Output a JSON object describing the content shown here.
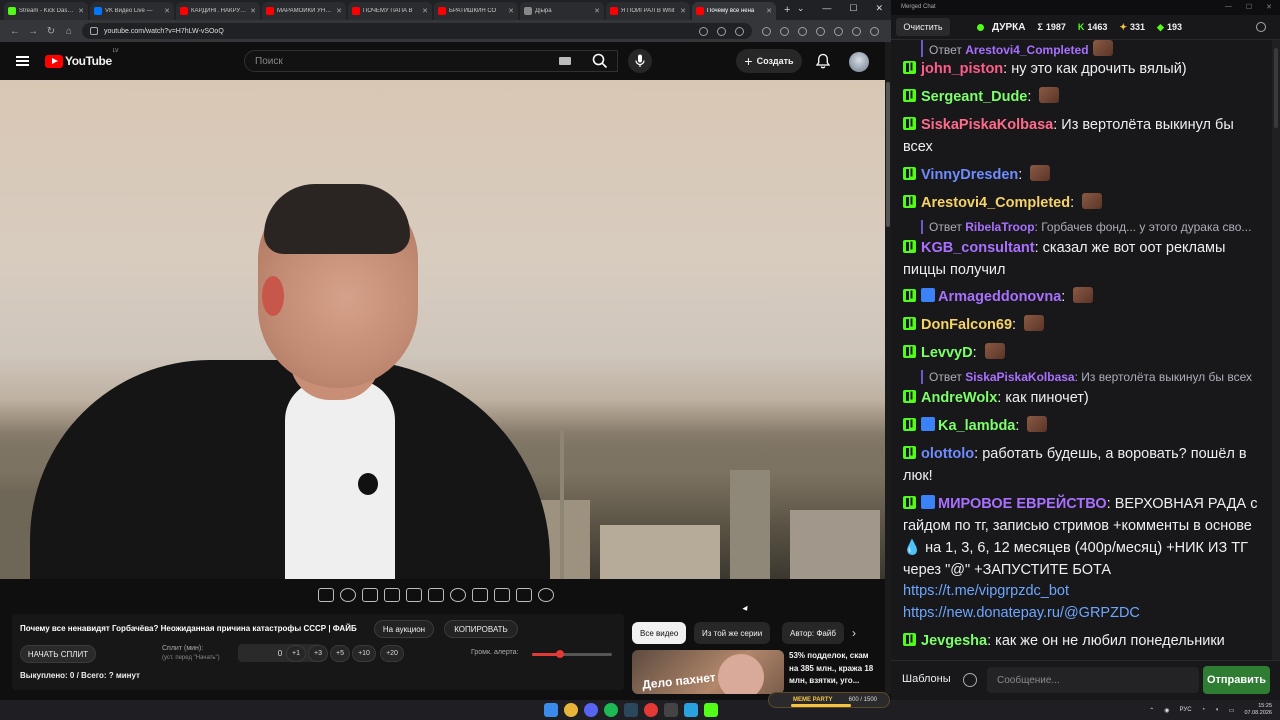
{
  "browser": {
    "tabs": [
      {
        "title": "Stream - Kick Dashboard",
        "color": "#53fc18",
        "active": false
      },
      {
        "title": "VK Видео Live —",
        "color": "#0077ff",
        "active": false
      },
      {
        "title": "КАРДИНГ. НАКРУТКА",
        "color": "#ff0000",
        "active": false
      },
      {
        "title": "МАРАМОЙКИ УНИЖ",
        "color": "#ff0000",
        "active": false
      },
      {
        "title": "ПОЧЕМУ ПАПА В",
        "color": "#ff0000",
        "active": false
      },
      {
        "title": "БРАТИШКИН СО",
        "color": "#ff0000",
        "active": false
      },
      {
        "title": "Д|ыра",
        "color": "#888888",
        "active": false
      },
      {
        "title": "Я ПОИГРАЛ В Whit",
        "color": "#ff0000",
        "active": false
      },
      {
        "title": "Почему все нена",
        "color": "#ff0000",
        "active": true
      }
    ],
    "url": "youtube.com/watch?v=H7hLW-vSOoQ"
  },
  "youtube": {
    "logo_text": "YouTube",
    "region": "LV",
    "search_placeholder": "Поиск",
    "create_label": "Создать",
    "video_title": "Почему все ненавидят Горбачёва? Неожиданная причина катастрофы СССР | ФАЙБ",
    "auction_label": "На аукцион",
    "copy_label": "КОПИРОВАТЬ",
    "start_split_label": "НАЧАТЬ СПЛИТ",
    "split_label": "Сплит (мин):",
    "split_sub": "(уст. перед \"Начать\")",
    "split_value": "0",
    "increments": [
      "+1",
      "+3",
      "+5",
      "+10",
      "+20"
    ],
    "volume_label": "Громк. алерта:",
    "volume_level": 0.35,
    "sold_text": "Выкуплено: 0 / Всего: ? минут",
    "chips": [
      "Все видео",
      "Из той же серии",
      "Автор: Файб"
    ],
    "rec_thumb_text": "Дело пахнет",
    "rec_title": "53% подделок, скам на 385 млн., кража 18 млн, взятки, уго..."
  },
  "chat": {
    "window_title": "Merged Chat",
    "clear_label": "Очистить",
    "channel": "ДУРКА",
    "stats": [
      {
        "icon": "Σ",
        "value": "1987",
        "color": "#efeff1"
      },
      {
        "icon": "K",
        "value": "1463",
        "color": "#53fc18"
      },
      {
        "icon": "✦",
        "value": "331",
        "color": "#f6c343"
      },
      {
        "icon": "◆",
        "value": "193",
        "color": "#53fc18"
      }
    ],
    "templates_label": "Шаблоны",
    "input_placeholder": "Сообщение...",
    "send_label": "Отправить",
    "meme_party_label": "MEME PARTY",
    "meme_party_count": "600 / 1500"
  },
  "messages": [
    {
      "type": "reply",
      "prefix": "Ответ",
      "user": "Arestovi4_Completed",
      "text": ""
    },
    {
      "type": "msg",
      "user": "john_piston",
      "color": "#ff5c8a",
      "text": "ну это как дрочить вялый)"
    },
    {
      "type": "msg",
      "user": "Sergeant_Dude",
      "color": "#7dff6a",
      "text": ""
    },
    {
      "type": "msg",
      "user": "SiskaPiskaKolbasa",
      "color": "#ff6b8b",
      "text": "Из вертолёта выкинул бы всех"
    },
    {
      "type": "msg",
      "user": "VinnyDresden",
      "color": "#6f8cff",
      "text": ""
    },
    {
      "type": "msg",
      "user": "Arestovi4_Completed",
      "color": "#f6d365",
      "text": ""
    },
    {
      "type": "reply",
      "prefix": "Ответ",
      "user": "RibelaTroop",
      "text": "Горбачев фонд... у этого дурака сво..."
    },
    {
      "type": "msg",
      "user": "KGB_consultant",
      "color": "#a970ff",
      "text": "сказал же вот оот рекламы пиццы получил"
    },
    {
      "type": "msg",
      "user": "Armageddonovna",
      "color": "#a970ff",
      "text": ""
    },
    {
      "type": "msg",
      "user": "DonFalcon69",
      "color": "#f6d365",
      "text": ""
    },
    {
      "type": "msg",
      "user": "LevvyD",
      "color": "#7dff6a",
      "text": ""
    },
    {
      "type": "reply",
      "prefix": "Ответ",
      "user": "SiskaPiskaKolbasa",
      "text": "Из вертолёта выкинул бы всех"
    },
    {
      "type": "msg",
      "user": "AndreWolx",
      "color": "#7dff6a",
      "text": "как пиночет)"
    },
    {
      "type": "msg",
      "user": "Ka_lambda",
      "color": "#7dff6a",
      "text": ""
    },
    {
      "type": "msg",
      "user": "olottolo",
      "color": "#6f8cff",
      "text": "работать будешь, а воровать? пошёл в люк!"
    },
    {
      "type": "msg",
      "user": "МИРОВОЕ ЕВРЕЙСТВО",
      "color": "#a970ff",
      "text": "ВЕРХОВНАЯ РАДА с гайдом по тг, записью стримов +комменты в основе 💧 на 1, 3, 6, 12 месяцев (400р/месяц) +НИК ИЗ ТГ через \"@\" +ЗАПУСТИТЕ БОТА"
    },
    {
      "type": "link",
      "text": "https://t.me/vipgrpzdc_bot"
    },
    {
      "type": "link",
      "text": "https://new.donatepay.ru/@GRPZDC"
    },
    {
      "type": "msg",
      "user": "Jevgesha",
      "color": "#7dff6a",
      "text": "как же он не любил понедельники"
    }
  ],
  "taskbar": {
    "lang": "РУС",
    "time": "15:25",
    "date": "07.08.2026"
  }
}
